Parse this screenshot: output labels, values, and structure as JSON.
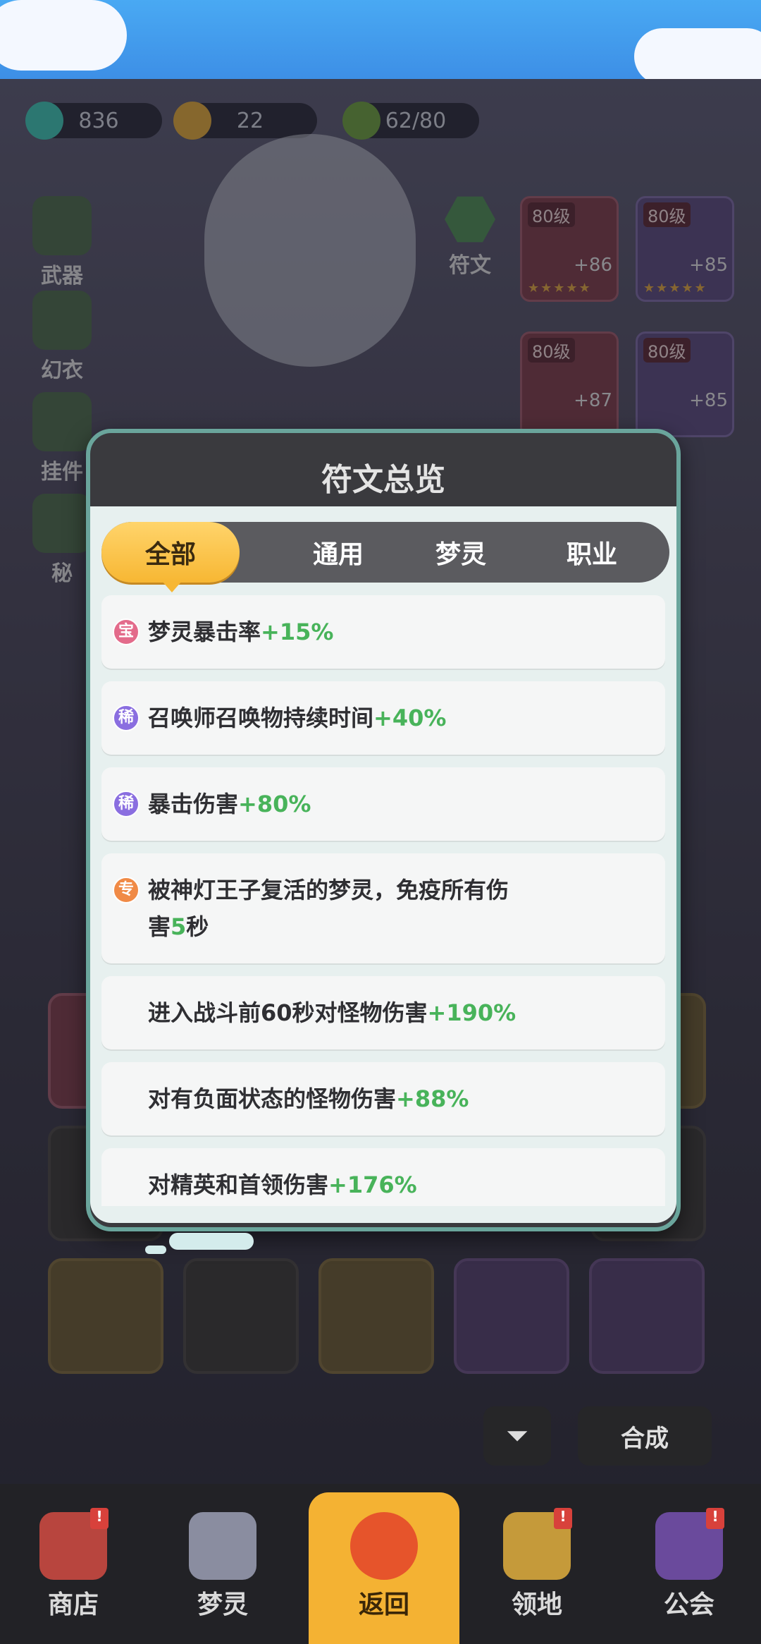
{
  "resources": {
    "gems": "836",
    "gold": "22",
    "stamina": "62/80"
  },
  "side_menu": {
    "weapon": "武器",
    "costume": "幻衣",
    "pendant": "挂件",
    "secret": "秘",
    "rune": "符文"
  },
  "equipment": [
    {
      "level": "80级",
      "plus": "+86"
    },
    {
      "level": "80级",
      "plus": "+85"
    },
    {
      "level": "80级",
      "plus": "+87"
    },
    {
      "level": "80级",
      "plus": "+85"
    }
  ],
  "modal": {
    "title": "符文总览",
    "tabs": [
      "全部",
      "通用",
      "梦灵",
      "职业"
    ],
    "active_tab": "全部",
    "rows": [
      {
        "badge": "宝",
        "badge_type": "bao",
        "text": "梦灵暴击率",
        "value": "+15%"
      },
      {
        "badge": "稀",
        "badge_type": "xi",
        "text": "召唤师召唤物持续时间",
        "value": "+40%"
      },
      {
        "badge": "稀",
        "badge_type": "xi",
        "text": "暴击伤害",
        "value": "+80%"
      },
      {
        "badge": "专",
        "badge_type": "zhuan",
        "text_a": "被神灯王子复活的梦灵，免疫所有伤",
        "text_b": "害",
        "value": "5",
        "text_c": "秒"
      },
      {
        "badge": "",
        "text": "进入战斗前60秒对怪物伤害",
        "value": "+190%"
      },
      {
        "badge": "",
        "text": "对有负面状态的怪物伤害",
        "value": "+88%"
      },
      {
        "badge": "",
        "text": "对精英和首领伤害",
        "value": "+176%"
      }
    ]
  },
  "buttons": {
    "merge": "合成"
  },
  "nav": {
    "shop": "商店",
    "spirit": "梦灵",
    "back": "返回",
    "territory": "领地",
    "guild": "公会",
    "alert": "!"
  },
  "colors": {
    "accent_gold": "#f7b733",
    "value_green": "#48b35a",
    "modal_border": "#6aa59c"
  }
}
